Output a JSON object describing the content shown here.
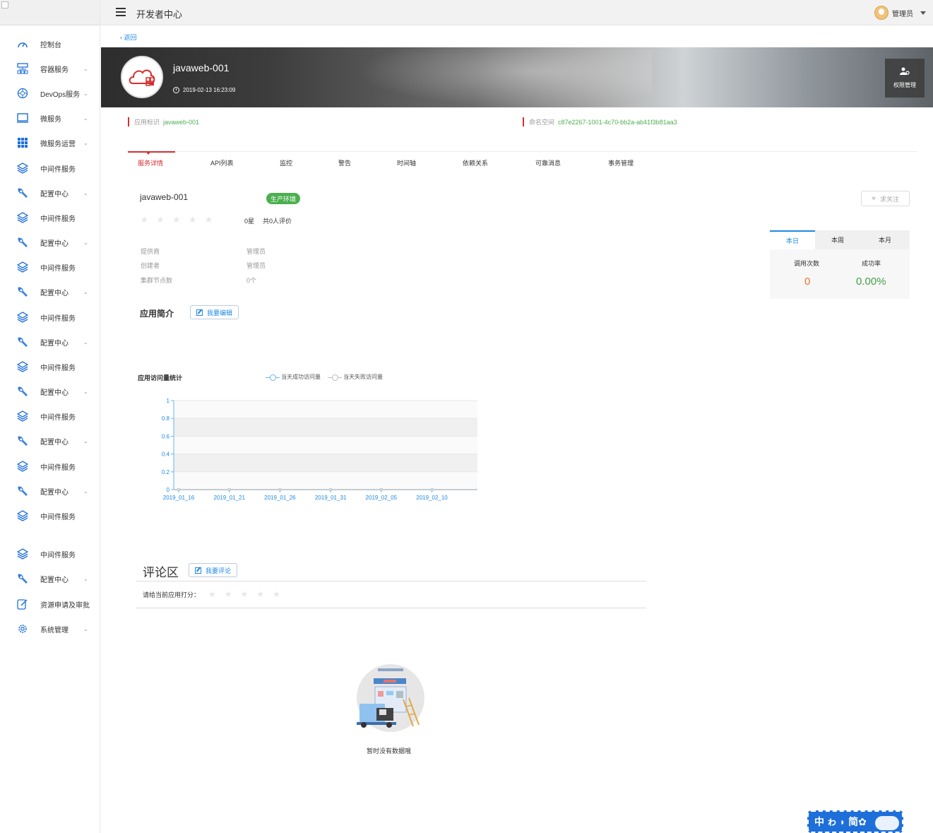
{
  "header": {
    "title": "开发者中心",
    "user": "管理员"
  },
  "sidebar": {
    "items": [
      {
        "label": "控制台",
        "icon": "dashboard-icon",
        "chevron": false
      },
      {
        "label": "容器服务",
        "icon": "container-icon",
        "chevron": true
      },
      {
        "label": "DevOps服务",
        "icon": "devops-icon",
        "chevron": true
      },
      {
        "label": "微服务",
        "icon": "monitor-icon",
        "chevron": true
      },
      {
        "label": "微服务运营",
        "icon": "grid-icon",
        "chevron": true
      },
      {
        "label": "中间件服务",
        "icon": "layers-icon",
        "chevron": false
      },
      {
        "label": "配置中心",
        "icon": "wrench-icon",
        "chevron": true
      },
      {
        "label": "中间件服务",
        "icon": "layers-icon",
        "chevron": false
      },
      {
        "label": "配置中心",
        "icon": "wrench-icon",
        "chevron": true
      },
      {
        "label": "中间件服务",
        "icon": "layers-icon",
        "chevron": false
      },
      {
        "label": "配置中心",
        "icon": "wrench-icon",
        "chevron": true
      },
      {
        "label": "中间件服务",
        "icon": "layers-icon",
        "chevron": false
      },
      {
        "label": "配置中心",
        "icon": "wrench-icon",
        "chevron": true
      },
      {
        "label": "中间件服务",
        "icon": "layers-icon",
        "chevron": false
      },
      {
        "label": "配置中心",
        "icon": "wrench-icon",
        "chevron": true
      },
      {
        "label": "中间件服务",
        "icon": "layers-icon",
        "chevron": false
      },
      {
        "label": "配置中心",
        "icon": "wrench-icon",
        "chevron": true
      },
      {
        "label": "中间件服务",
        "icon": "layers-icon",
        "chevron": false
      },
      {
        "label": "配置中心",
        "icon": "wrench-icon",
        "chevron": true
      },
      {
        "label": "中间件服务",
        "icon": "layers-icon",
        "chevron": false
      },
      {
        "label": "中间件服务",
        "icon": "layers-icon",
        "chevron": false
      },
      {
        "label": "配置中心",
        "icon": "wrench-icon",
        "chevron": true
      },
      {
        "label": "资源申请及审批",
        "icon": "edit-doc-icon",
        "chevron": false
      },
      {
        "label": "系统管理",
        "icon": "gear-icon",
        "chevron": true
      }
    ]
  },
  "back_label": "返回",
  "app": {
    "name": "javaweb-001",
    "created_at": "2019-02-13 16:23:09",
    "perm_label": "权限管理",
    "id_label": "应用标识",
    "id_value": "javaweb-001",
    "ns_label": "命名空间",
    "ns_value": "c87e2267-1001-4c70-bb2a-ab41f3b81aa3"
  },
  "tabs": [
    "服务详情",
    "API列表",
    "监控",
    "警告",
    "时间轴",
    "依赖关系",
    "可靠消息",
    "事务管理"
  ],
  "detail": {
    "name": "javaweb-001",
    "env_badge": "生产环境",
    "rating_value": "0星",
    "rating_count": "共0人评价",
    "follow_label": "求关注",
    "fields": [
      {
        "key": "提供商",
        "value": "管理员"
      },
      {
        "key": "创建者",
        "value": "管理员"
      },
      {
        "key": "集群节点数",
        "value": "0个"
      }
    ],
    "intro_title": "应用简介",
    "edit_label": "我要编辑"
  },
  "stats": {
    "tabs": [
      "本日",
      "本周",
      "本月"
    ],
    "calls_label": "调用次数",
    "success_label": "成功率",
    "calls_value": "0",
    "success_value": "0.00%",
    "colors": {
      "calls": "#e8712c",
      "success": "#43a047"
    }
  },
  "chart_data": {
    "type": "line",
    "title": "应用访问量统计",
    "x_tick_labels": [
      "2019_01_16",
      "2019_01_21",
      "2019_01_26",
      "2019_01_31",
      "2019_02_05",
      "2019_02_10"
    ],
    "y_ticks": [
      "0",
      "0.2",
      "0.4",
      "0.6",
      "0.8",
      "1"
    ],
    "ylim": [
      0,
      1
    ],
    "grid": true,
    "series": [
      {
        "name": "当天成功访问量",
        "color": "#64b5f6",
        "values": [
          0,
          0,
          0,
          0,
          0,
          0
        ]
      },
      {
        "name": "当天失败访问量",
        "color": "#bbbbbb",
        "values": [
          0,
          0,
          0,
          0,
          0,
          0
        ]
      }
    ]
  },
  "comments": {
    "title": "评论区",
    "write_label": "我要评论",
    "rate_prompt": "请给当前应用打分：",
    "empty_text": "暂时没有数据哦"
  },
  "ime": {
    "text": "中 ゎ ◗ 简"
  }
}
